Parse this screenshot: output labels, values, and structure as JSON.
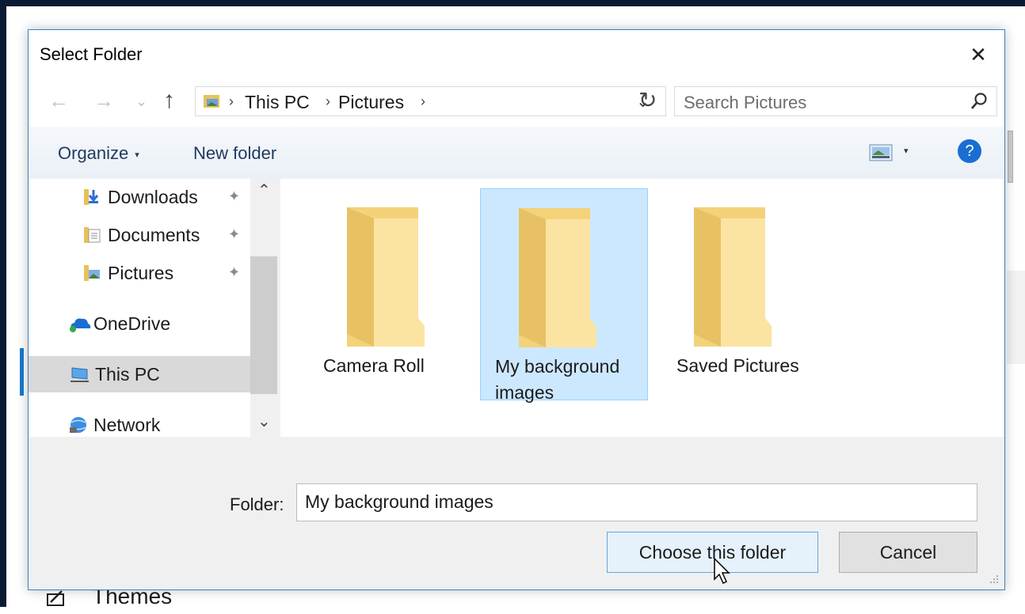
{
  "dialog": {
    "title": "Select Folder",
    "close_glyph": "✕"
  },
  "nav": {
    "back_glyph": "←",
    "forward_glyph": "→",
    "recent_glyph": "⌄",
    "up_glyph": "↑",
    "breadcrumbs": [
      "This PC",
      "Pictures"
    ],
    "separator_glyph": "›",
    "dropdown_glyph": "⌄",
    "refresh_glyph": "↻",
    "search_placeholder": "Search Pictures"
  },
  "toolbar": {
    "organize_label": "Organize",
    "organize_arrow": "▾",
    "new_folder_label": "New folder",
    "view_arrow": "▾",
    "help_glyph": "?"
  },
  "sidebar": {
    "items": [
      {
        "label": "Downloads",
        "icon": "downloads-icon",
        "pinned": true
      },
      {
        "label": "Documents",
        "icon": "documents-icon",
        "pinned": true
      },
      {
        "label": "Pictures",
        "icon": "pictures-icon",
        "pinned": true
      },
      {
        "label": "OneDrive",
        "icon": "onedrive-icon"
      },
      {
        "label": "This PC",
        "icon": "this-pc-icon",
        "selected": true
      },
      {
        "label": "Network",
        "icon": "network-icon"
      }
    ],
    "pin_glyph": "✦",
    "scroll_up_glyph": "⌃",
    "scroll_down_glyph": "⌄"
  },
  "folders": [
    {
      "label": "Camera Roll",
      "selected": false
    },
    {
      "label": "My background images",
      "selected": true
    },
    {
      "label": "Saved Pictures",
      "selected": false
    }
  ],
  "footer": {
    "folder_label": "Folder:",
    "folder_value": "My background images",
    "choose_label": "Choose this folder",
    "cancel_label": "Cancel"
  },
  "background": {
    "themes_label": "Themes"
  },
  "colors": {
    "accent": "#1979ca",
    "selection": "#cce8ff",
    "folder": "#f5d77f",
    "help": "#1a6ed1"
  }
}
